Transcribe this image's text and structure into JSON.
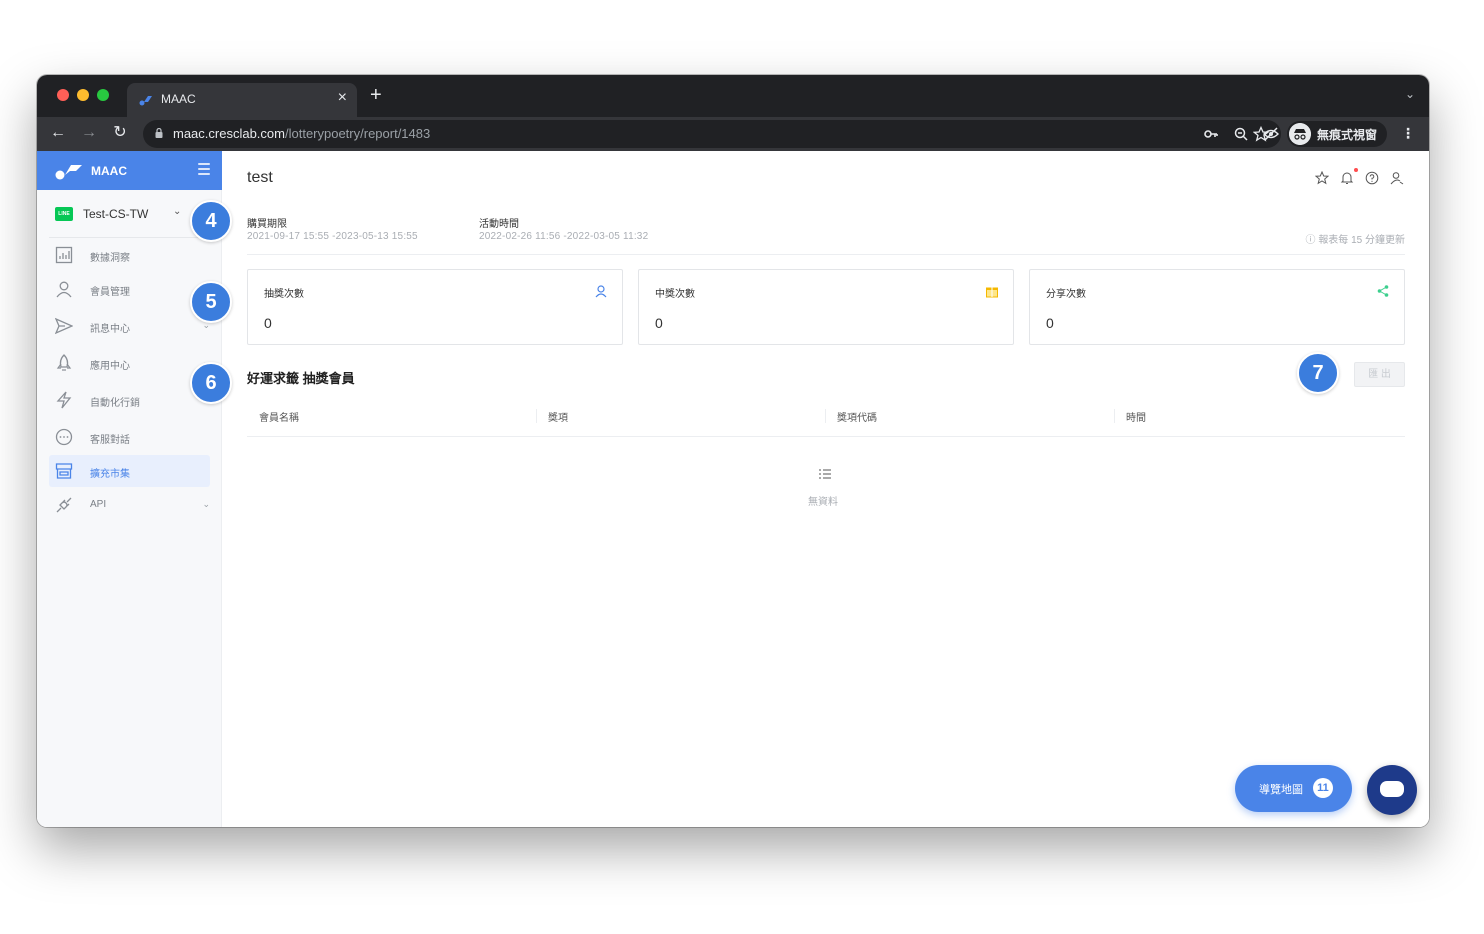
{
  "browser": {
    "tab_title": "MAAC",
    "new_tab": "+",
    "url_host": "maac.cresclab.com",
    "url_path": "/lotterypoetry/report/1483",
    "incognito_label": "無痕式視窗"
  },
  "sidebar": {
    "brand": "MAAC",
    "account_badge": "LINE",
    "account_name": "Test-CS-TW",
    "items": [
      {
        "label": "數據洞察",
        "icon": "bar-chart-icon"
      },
      {
        "label": "會員管理",
        "icon": "user-icon"
      },
      {
        "label": "訊息中心",
        "icon": "send-icon"
      },
      {
        "label": "應用中心",
        "icon": "rocket-icon"
      },
      {
        "label": "自動化行銷",
        "icon": "lightning-icon"
      },
      {
        "label": "客服對話",
        "icon": "chat-icon"
      },
      {
        "label": "擴充市集",
        "icon": "store-icon"
      },
      {
        "label": "API",
        "icon": "plug-icon"
      }
    ],
    "active_index": 6
  },
  "page": {
    "title": "test",
    "purchase_label": "購買期限",
    "purchase_value": "2021-09-17 15:55 -2023-05-13 15:55",
    "activity_label": "活動時間",
    "activity_value": "2022-02-26 11:56 -2022-03-05 11:32",
    "refresh_note": "報表每 15 分鐘更新"
  },
  "stats": [
    {
      "label": "抽獎次數",
      "value": "0",
      "icon": "user-icon",
      "color": "#4a84e8"
    },
    {
      "label": "中獎次數",
      "value": "0",
      "icon": "gift-icon",
      "color": "#f5b800"
    },
    {
      "label": "分享次數",
      "value": "0",
      "icon": "share-icon",
      "color": "#3ccf8e"
    }
  ],
  "table": {
    "title": "好運求籤 抽獎會員",
    "export_label": "匯 出",
    "columns": [
      "會員名稱",
      "獎項",
      "獎項代碼",
      "時間"
    ],
    "empty_text": "無資料"
  },
  "markers": [
    "4",
    "5",
    "6",
    "7"
  ],
  "guide": {
    "label": "導覽地圖",
    "count": "11"
  }
}
